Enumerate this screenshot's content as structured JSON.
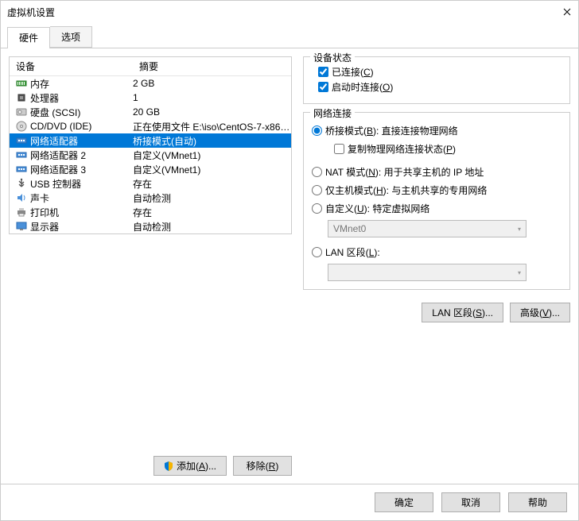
{
  "window_title": "虚拟机设置",
  "tabs": {
    "hardware": "硬件",
    "options": "选项"
  },
  "list_header": {
    "device": "设备",
    "summary": "摘要"
  },
  "devices": [
    {
      "icon": "memory",
      "name": "内存",
      "summary": "2 GB"
    },
    {
      "icon": "cpu",
      "name": "处理器",
      "summary": "1"
    },
    {
      "icon": "disk",
      "name": "硬盘 (SCSI)",
      "summary": "20 GB"
    },
    {
      "icon": "cd",
      "name": "CD/DVD (IDE)",
      "summary": "正在使用文件 E:\\iso\\CentOS-7-x86_..."
    },
    {
      "icon": "net",
      "name": "网络适配器",
      "summary": "桥接模式(自动)",
      "selected": true
    },
    {
      "icon": "net",
      "name": "网络适配器 2",
      "summary": "自定义(VMnet1)"
    },
    {
      "icon": "net",
      "name": "网络适配器 3",
      "summary": "自定义(VMnet1)"
    },
    {
      "icon": "usb",
      "name": "USB 控制器",
      "summary": "存在"
    },
    {
      "icon": "sound",
      "name": "声卡",
      "summary": "自动检测"
    },
    {
      "icon": "printer",
      "name": "打印机",
      "summary": "存在"
    },
    {
      "icon": "display",
      "name": "显示器",
      "summary": "自动检测"
    }
  ],
  "left_buttons": {
    "add": "添加(A)...",
    "remove": "移除(R)"
  },
  "device_state": {
    "legend": "设备状态",
    "connected": "已连接(C)",
    "connect_at_poweron": "启动时连接(O)"
  },
  "net_conn": {
    "legend": "网络连接",
    "bridged": "桥接模式(B): 直接连接物理网络",
    "replicate": "复制物理网络连接状态(P)",
    "nat": "NAT 模式(N): 用于共享主机的 IP 地址",
    "hostonly": "仅主机模式(H): 与主机共享的专用网络",
    "custom": "自定义(U): 特定虚拟网络",
    "custom_dropdown": "VMnet0",
    "lan_segment": "LAN 区段(L):",
    "lan_segments_btn": "LAN 区段(S)...",
    "advanced_btn": "高级(V)..."
  },
  "dialog_buttons": {
    "ok": "确定",
    "cancel": "取消",
    "help": "帮助"
  }
}
